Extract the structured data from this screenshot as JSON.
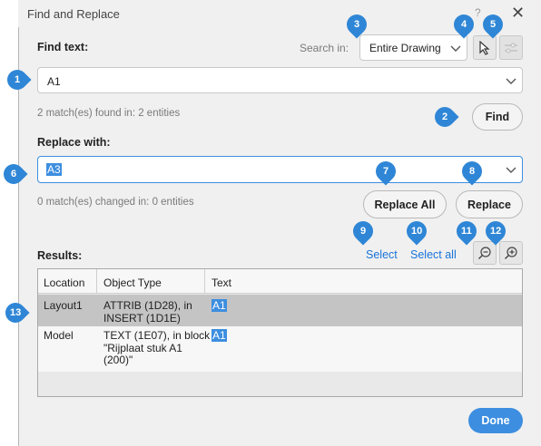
{
  "window": {
    "title": "Find and Replace",
    "help": "?",
    "close": "✕"
  },
  "find": {
    "label": "Find text:",
    "value": "A1",
    "status": "2 match(es) found in: 2 entities",
    "search_in_label": "Search in:",
    "search_in_value": "Entire Drawing",
    "find_button": "Find"
  },
  "replace": {
    "label": "Replace with:",
    "value": "A3",
    "status": "0 match(es) changed in: 0 entities",
    "replace_all_button": "Replace All",
    "replace_button": "Replace"
  },
  "results": {
    "label": "Results:",
    "select_link": "Select",
    "select_all_link": "Select all",
    "columns": [
      "Location",
      "Object Type",
      "Text"
    ],
    "rows": [
      {
        "location": "Layout1",
        "type_line1": "ATTRIB (1D28), in",
        "type_line2": "INSERT (1D1E)",
        "type_line3": "",
        "text": "A1"
      },
      {
        "location": "Model",
        "type_line1": "TEXT (1E07), in block",
        "type_line2": "\"Rijplaat stuk A1",
        "type_line3": "(200)\"",
        "text": "A1"
      }
    ]
  },
  "done_button": "Done",
  "icons": {
    "select_objects": "cursor-arrow-icon",
    "settings": "settings-sliders-icon",
    "zoom_out": "zoom-out-icon",
    "zoom_in": "zoom-in-icon",
    "dropdown": "chevron-down-icon"
  },
  "callouts": [
    "1",
    "2",
    "3",
    "4",
    "5",
    "6",
    "7",
    "8",
    "9",
    "10",
    "11",
    "12",
    "13"
  ],
  "colors": {
    "accent": "#3d8ee0",
    "callout": "#2f86d6",
    "link": "#1a73d9",
    "selected_row": "#c4c4c4"
  }
}
